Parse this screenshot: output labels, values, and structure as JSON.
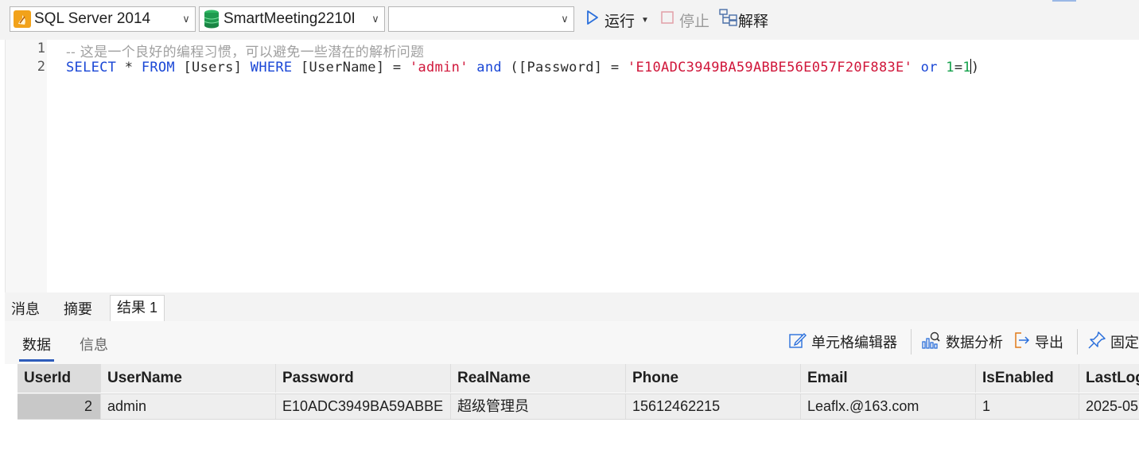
{
  "toolbar": {
    "connection": "SQL Server 2014",
    "database": "SmartMeeting2210I",
    "schema": "",
    "run_label": "运行",
    "stop_label": "停止",
    "explain_label": "解释"
  },
  "editor": {
    "line_numbers": [
      "1",
      "2"
    ],
    "line1_comment": "-- 这是一个良好的编程习惯，可以避免一些潜在的解析问题",
    "line2": {
      "select": "SELECT",
      "star": " * ",
      "from": "FROM",
      "table": " [Users] ",
      "where": "WHERE",
      "col1": " [UserName] = ",
      "val1": "'admin'",
      "sp1": " ",
      "and": "and",
      "col2": " ([Password] = ",
      "val2": "'E10ADC3949BA59ABBE56E057F20F883E'",
      "sp2": " ",
      "or": "or",
      "sp3": " ",
      "n1": "1",
      "eq": "=",
      "n2": "1",
      "close": ")"
    }
  },
  "panel": {
    "tabs": [
      "消息",
      "摘要",
      "结果 1"
    ],
    "subtabs": [
      "数据",
      "信息"
    ],
    "actions": {
      "cell_editor": "单元格编辑器",
      "data_analysis": "数据分析",
      "export": "导出",
      "pin": "固定"
    }
  },
  "grid": {
    "columns": [
      "UserId",
      "UserName",
      "Password",
      "RealName",
      "Phone",
      "Email",
      "IsEnabled",
      "LastLog"
    ],
    "rows": [
      [
        "2",
        "admin",
        "E10ADC3949BA59ABBE",
        "超级管理员",
        "15612462215",
        "Leaflx.@163.com",
        "1",
        "2025-05"
      ]
    ]
  },
  "colors": {
    "keyword": "#1a47d6",
    "string": "#d0163a",
    "number": "#13a04a",
    "comment": "#a0a0a0",
    "accent": "#2e5cbb"
  }
}
